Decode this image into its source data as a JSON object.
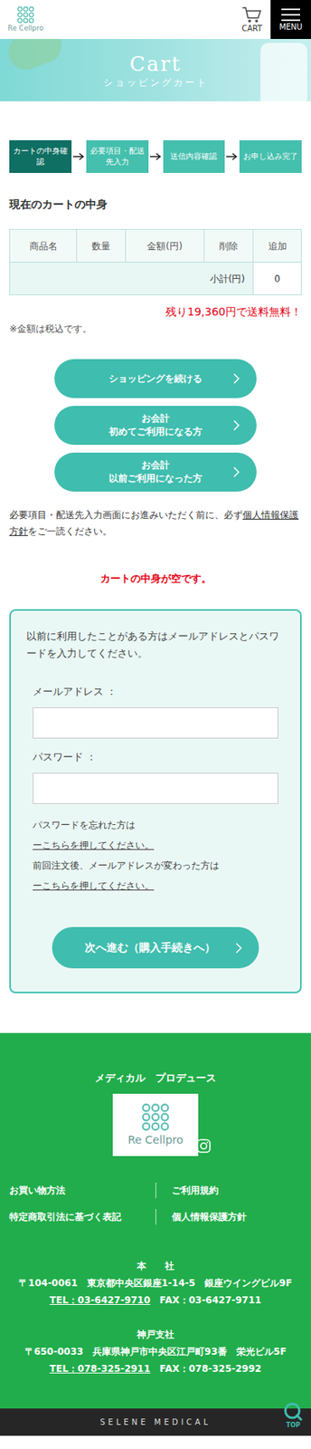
{
  "header": {
    "logo_text": "Re Cellpro",
    "cart_label": "CART",
    "menu_label": "MENU"
  },
  "banner": {
    "title": "Cart",
    "subtitle": "ショッピングカート"
  },
  "steps": [
    {
      "label": "カートの中身確認",
      "selected": true
    },
    {
      "label": "必要項目・配送先入力",
      "selected": false
    },
    {
      "label": "送信内容確認",
      "selected": false
    },
    {
      "label": "お申し込み完了",
      "selected": false
    }
  ],
  "cart": {
    "heading": "現在のカートの中身",
    "columns": [
      "商品名",
      "数量",
      "金額(円)",
      "削除",
      "追加"
    ],
    "subtotal_label": "小計(円)",
    "subtotal": "0",
    "free_shipping": "残り19,360円で送料無料！",
    "tax_note": "※金額は税込です。"
  },
  "actions": [
    {
      "lines": [
        "ショッピングを続ける"
      ]
    },
    {
      "lines": [
        "お会計",
        "初めてご利用になる方"
      ]
    },
    {
      "lines": [
        "お会計",
        "以前ご利用になった方"
      ]
    }
  ],
  "privacy_notice": {
    "before": "必要項目・配送先入力画面にお進みいただく前に、必ず",
    "link": "個人情報保護方針",
    "after": "をご一読ください。"
  },
  "empty_message": "カートの中身が空です。",
  "login": {
    "intro": "以前に利用したことがある方はメールアドレスとパスワードを入力してください。",
    "email_label": "メールアドレス ：",
    "password_label": "パスワード ：",
    "forgot_text": "パスワードを忘れた方は",
    "forgot_link": "ーこちらを押してください。",
    "email_change_text": "前回注文後、メールアドレスが変わった方は",
    "email_change_link": "ーこちらを押してください。",
    "submit": "次へ進む（購入手続きへ）"
  },
  "footer": {
    "produce": "メディカル　プロデュース",
    "logo_text": "Re Cellpro",
    "links": [
      "お買い物方法",
      "ご利用規約",
      "特定商取引法に基づく表記",
      "個人情報保護方針"
    ],
    "offices": [
      {
        "name": "本　　社",
        "address": "〒104-0061　東京都中央区銀座1-14-5　銀座ウイングビル9F",
        "tel": "TEL：03-6427-9710",
        "fax": "FAX：03-6427-9711"
      },
      {
        "name": "神戸支社",
        "address": "〒650-0033　兵庫県神戸市中央区江戸町93番　栄光ビル5F",
        "tel": "TEL：078-325-2911",
        "fax": "FAX：078-325-2992"
      }
    ],
    "brand": "SELENE MEDICAL"
  },
  "top_button": "TOP"
}
